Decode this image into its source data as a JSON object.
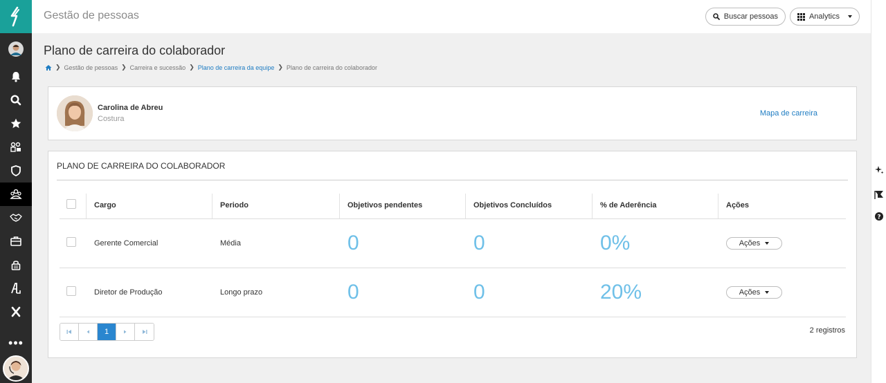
{
  "app": {
    "title": "Gestão de pessoas"
  },
  "header": {
    "search_label": "Buscar pessoas",
    "analytics_label": "Analytics"
  },
  "page": {
    "title": "Plano de carreira do colaborador"
  },
  "breadcrumb": {
    "items": [
      "Gestão de pessoas",
      "Carreira e sucessão",
      "Plano de carreira da equipe",
      "Plano de carreira do colaborador"
    ]
  },
  "profile": {
    "name": "Carolina de Abreu",
    "role": "Costura",
    "career_map_link": "Mapa de carreira"
  },
  "plan": {
    "section_title": "PLANO DE CARREIRA DO COLABORADOR",
    "columns": [
      "Cargo",
      "Periodo",
      "Objetivos pendentes",
      "Objetivos Concluídos",
      "% de Aderência",
      "Ações"
    ],
    "rows": [
      {
        "cargo": "Gerente Comercial",
        "periodo": "Média",
        "pendentes": "0",
        "concluidos": "0",
        "aderencia": "0%",
        "acoes": "Ações"
      },
      {
        "cargo": "Diretor de Produção",
        "periodo": "Longo prazo",
        "pendentes": "0",
        "concluidos": "0",
        "aderencia": "20%",
        "acoes": "Ações"
      }
    ],
    "pagination": {
      "current_page": "1"
    },
    "records": "2 registros"
  },
  "colors": {
    "brand": "#1aa19a",
    "link": "#1e7cc2",
    "metric": "#6fc0e8",
    "sidebar": "#2b2b2b"
  }
}
